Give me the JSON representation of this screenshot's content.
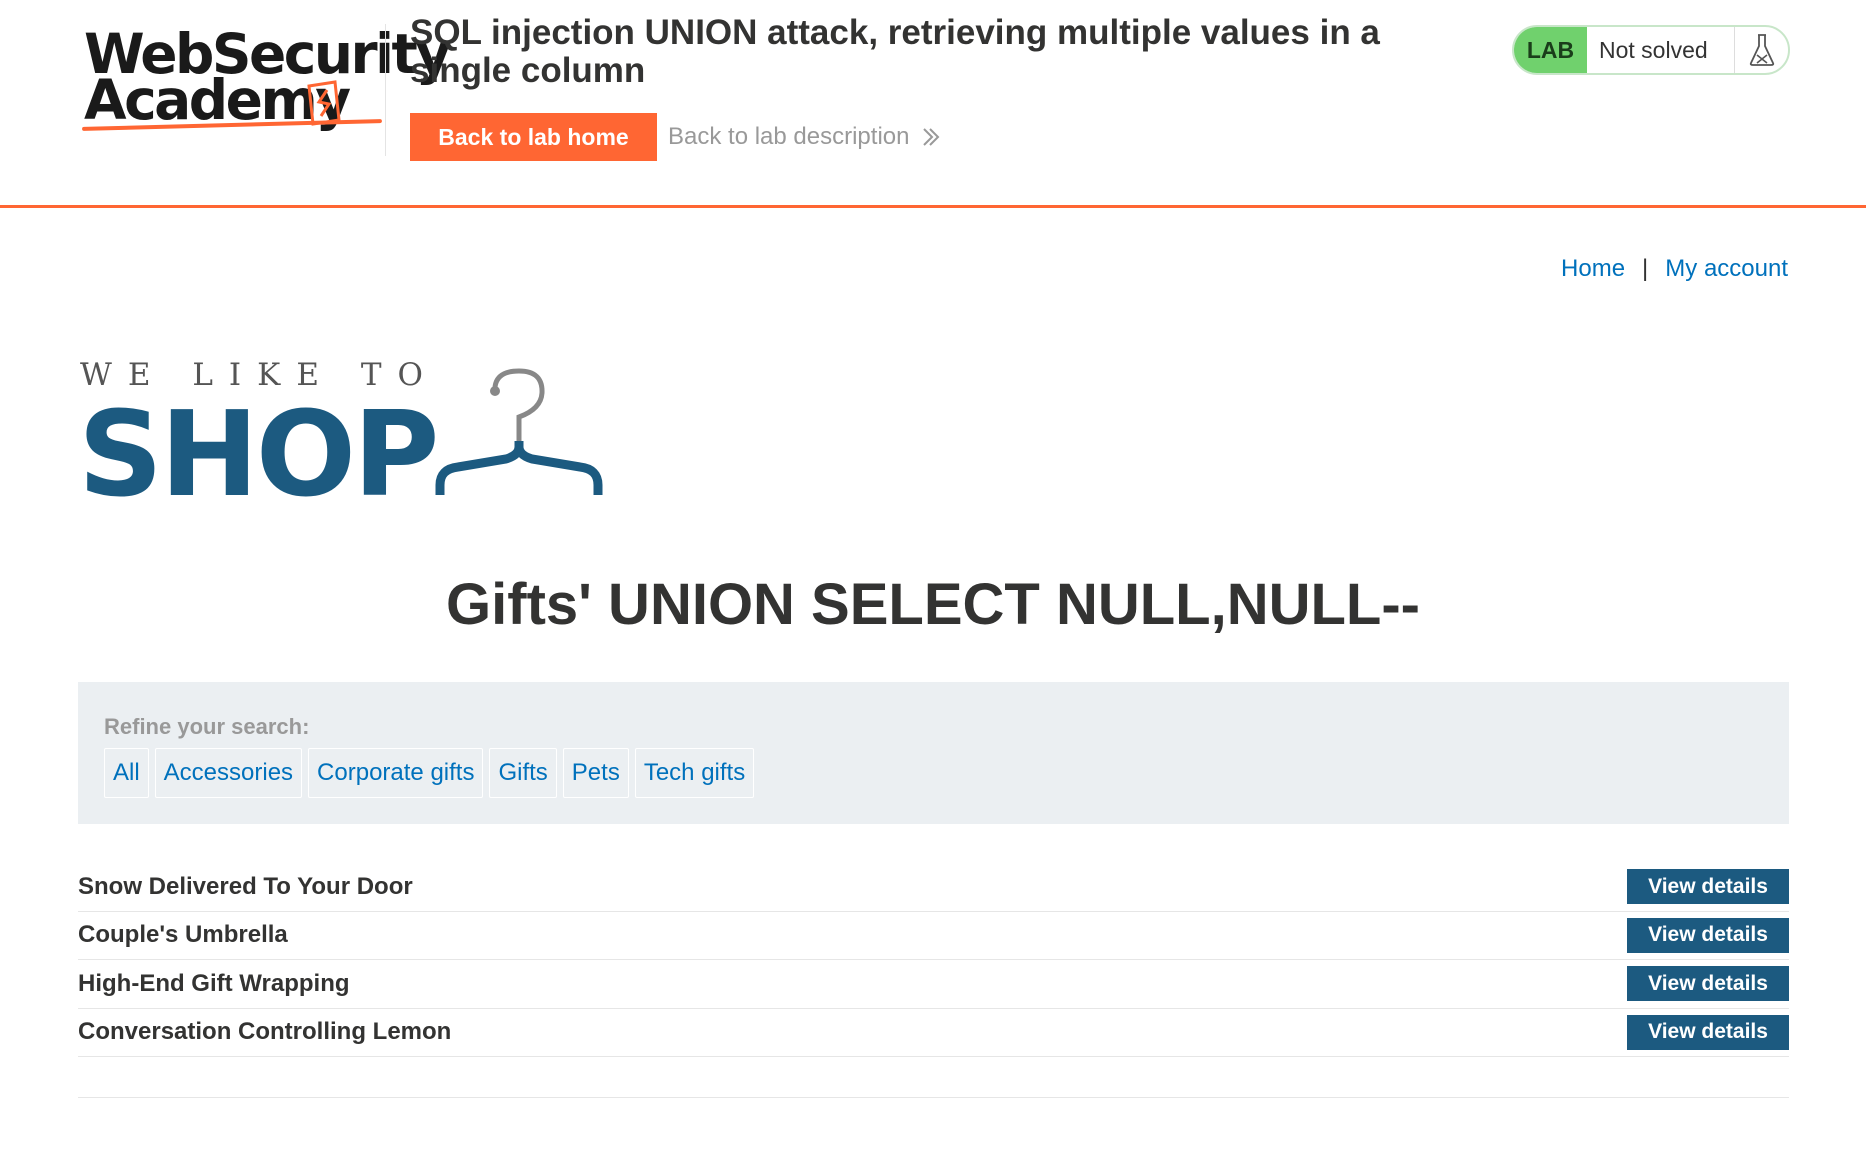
{
  "academy": {
    "logo_line1": "WebSecurity",
    "logo_line2": "Academy",
    "lab_title": "SQL injection UNION attack, retrieving multiple values in a single column",
    "back_home_label": "Back to lab home",
    "back_description_label": "Back to lab description",
    "lab_tag": "LAB",
    "lab_status": "Not solved",
    "flask_icon": "flask-icon"
  },
  "nav": {
    "home": "Home",
    "separator": "|",
    "account": "My account"
  },
  "shop_logo": {
    "tagline": "WE LIKE TO",
    "word": "SHOP"
  },
  "page_heading": "Gifts' UNION SELECT NULL,NULL--",
  "filter": {
    "label": "Refine your search:",
    "categories": [
      "All",
      "Accessories",
      "Corporate gifts",
      "Gifts",
      "Pets",
      "Tech gifts"
    ]
  },
  "products": [
    {
      "name": "Snow Delivered To Your Door",
      "button": "View details"
    },
    {
      "name": "Couple's Umbrella",
      "button": "View details"
    },
    {
      "name": "High-End Gift Wrapping",
      "button": "View details"
    },
    {
      "name": "Conversation Controlling Lemon",
      "button": "View details"
    }
  ],
  "colors": {
    "accent": "#ff6633",
    "brand_blue": "#1c5a80",
    "link": "#0071bc",
    "lab_green": "#70d16d"
  }
}
